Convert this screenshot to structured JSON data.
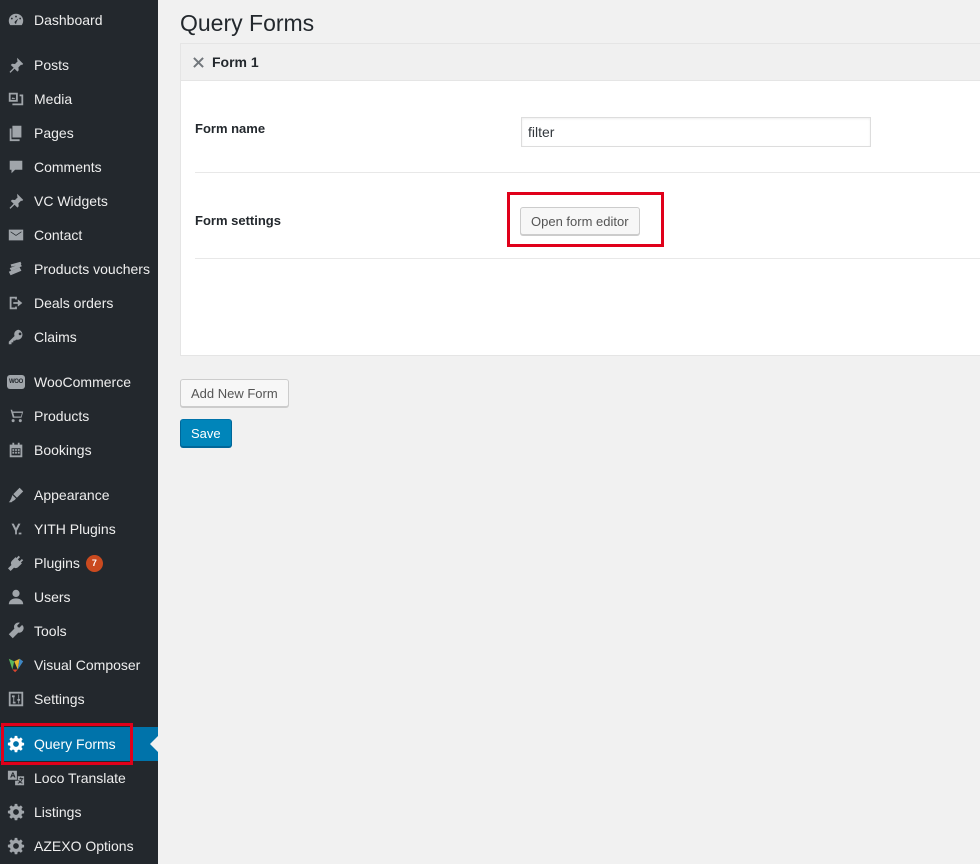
{
  "sidebar": {
    "items": [
      {
        "label": "Dashboard",
        "icon": "dashboard-icon"
      },
      {
        "label": "Posts",
        "icon": "pushpin-icon"
      },
      {
        "label": "Media",
        "icon": "media-icon"
      },
      {
        "label": "Pages",
        "icon": "pages-icon"
      },
      {
        "label": "Comments",
        "icon": "comment-icon"
      },
      {
        "label": "VC Widgets",
        "icon": "pushpin-icon"
      },
      {
        "label": "Contact",
        "icon": "envelope-icon"
      },
      {
        "label": "Products vouchers",
        "icon": "tickets-icon"
      },
      {
        "label": "Deals orders",
        "icon": "exit-icon"
      },
      {
        "label": "Claims",
        "icon": "key-icon"
      },
      {
        "label": "WooCommerce",
        "icon": "woo-icon"
      },
      {
        "label": "Products",
        "icon": "cart-icon"
      },
      {
        "label": "Bookings",
        "icon": "calendar-icon"
      },
      {
        "label": "Appearance",
        "icon": "brush-icon"
      },
      {
        "label": "YITH Plugins",
        "icon": "yith-icon"
      },
      {
        "label": "Plugins",
        "icon": "plug-icon",
        "badge": "7"
      },
      {
        "label": "Users",
        "icon": "user-icon"
      },
      {
        "label": "Tools",
        "icon": "wrench-icon"
      },
      {
        "label": "Visual Composer",
        "icon": "visual-composer-icon"
      },
      {
        "label": "Settings",
        "icon": "settings-sliders-icon"
      },
      {
        "label": "Query Forms",
        "icon": "gear-icon",
        "current": true
      },
      {
        "label": "Loco Translate",
        "icon": "translate-icon"
      },
      {
        "label": "Listings",
        "icon": "gear-icon"
      },
      {
        "label": "AZEXO Options",
        "icon": "gear-icon"
      }
    ],
    "woo_icon_text": "WOO"
  },
  "main": {
    "page_title": "Query Forms",
    "form_card": {
      "title": "Form 1",
      "form_name_label": "Form name",
      "form_name_value": "filter",
      "form_settings_label": "Form settings",
      "open_editor_label": "Open form editor"
    },
    "add_new_form_label": "Add New Form",
    "save_label": "Save"
  },
  "colors": {
    "sidebar_bg": "#23282d",
    "current_bg": "#0073aa",
    "primary_button": "#0085ba",
    "highlight": "#e0001a",
    "badge": "#ca4a1f"
  }
}
